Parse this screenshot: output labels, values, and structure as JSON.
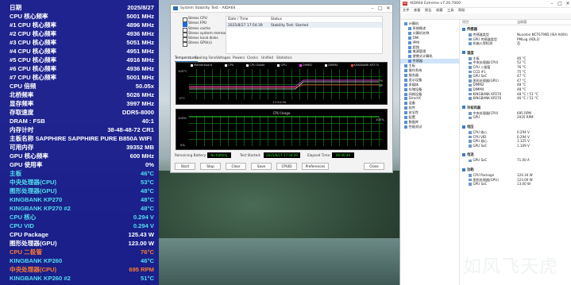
{
  "osd": {
    "rows": [
      {
        "k": "日期",
        "v": "2025/8/27",
        "c": "white"
      },
      {
        "k": "CPU 核心频率",
        "v": "5001 MHz",
        "c": "white"
      },
      {
        "k": "#1 CPU 核心频率",
        "v": "4896 MHz",
        "c": "white"
      },
      {
        "k": "#2 CPU 核心频率",
        "v": "4936 MHz",
        "c": "white"
      },
      {
        "k": "#3 CPU 核心频率",
        "v": "5051 MHz",
        "c": "white"
      },
      {
        "k": "#4 CPU 核心频率",
        "v": "4951 MHz",
        "c": "white"
      },
      {
        "k": "#5 CPU 核心频率",
        "v": "4916 MHz",
        "c": "white"
      },
      {
        "k": "#6 CPU 核心频率",
        "v": "4936 MHz",
        "c": "white"
      },
      {
        "k": "#7 CPU 核心频率",
        "v": "5001 MHz",
        "c": "white"
      },
      {
        "k": "CPU 倍频",
        "v": "50.05x",
        "c": "white"
      },
      {
        "k": "北桥频率",
        "v": "5026 MHz",
        "c": "white"
      },
      {
        "k": "显存频率",
        "v": "3997 MHz",
        "c": "white"
      },
      {
        "k": "存取速度",
        "v": "DDR5-8000",
        "c": "white"
      },
      {
        "k": "DRAM : FSB",
        "v": "40:1",
        "c": "white"
      },
      {
        "k": "内存计时",
        "v": "38-48-48-72 CR1",
        "c": "white"
      },
      {
        "k": "主板名称   SAPPHIRE SAPPHIRE PURE B850A WIFI",
        "v": "",
        "c": "white",
        "full": true
      },
      {
        "k": "可用内存",
        "v": "39352 MB",
        "c": "white"
      },
      {
        "k": "GPU 核心频率",
        "v": "600 MHz",
        "c": "white"
      },
      {
        "k": "GPU 使用率",
        "v": "0%",
        "c": "white"
      },
      {
        "k": "主板",
        "v": "46°C",
        "c": "cyan"
      },
      {
        "k": "中央处理器(CPU)",
        "v": "53°C",
        "c": "cyan"
      },
      {
        "k": "图形处理器(GPU)",
        "v": "48°C",
        "c": "cyan"
      },
      {
        "k": "KINGBANK KP270",
        "v": "48°C",
        "c": "cyan"
      },
      {
        "k": "KINGBANK KP270 #2",
        "v": "48°C",
        "c": "cyan"
      },
      {
        "k": "CPU 核心",
        "v": "0.294 V",
        "c": "cyan"
      },
      {
        "k": "CPU VID",
        "v": "0.294 V",
        "c": "cyan"
      },
      {
        "k": "CPU Package",
        "v": "125.43 W",
        "c": "white"
      },
      {
        "k": "图形处理器(GPU)",
        "v": "123.00 W",
        "c": "white"
      },
      {
        "k": "CPU 二极管",
        "v": "76°C",
        "c": "orange"
      },
      {
        "k": "KINGBANK KP260",
        "v": "46°C",
        "c": "cyan"
      },
      {
        "k": "中央处理器(CPU)",
        "v": "695 RPM",
        "c": "orange"
      },
      {
        "k": "KINGBANK KP260 #2",
        "v": "51°C",
        "c": "cyan"
      }
    ]
  },
  "stability": {
    "title": "System Stability Test - AIDA64",
    "checks": [
      {
        "label": "Stress CPU",
        "on": false
      },
      {
        "label": "Stress FPU",
        "on": true
      },
      {
        "label": "Stress cache",
        "on": false
      },
      {
        "label": "Stress system memory",
        "on": false
      },
      {
        "label": "Stress local disks",
        "on": false
      },
      {
        "label": "Stress GPU(s)",
        "on": false
      }
    ],
    "table_headers": {
      "date": "Date / Time",
      "status": "Status"
    },
    "table_row": {
      "date": "2025/8/27 17:54:39",
      "status": "Stability Test: Started"
    },
    "tabs": [
      "Temperatures",
      "Cooling Fans",
      "Voltages",
      "Powers",
      "Clocks",
      "Unified",
      "Statistics"
    ],
    "temp_graph": {
      "legend": [
        {
          "label": "Motherboard",
          "color": "#ffffff"
        },
        {
          "label": "CPU",
          "color": "#ffffff"
        },
        {
          "label": "CPU Diode",
          "color": "#ffffff"
        },
        {
          "label": "GPU",
          "color": "#ffffff"
        },
        {
          "label": "DIMM2",
          "color": "#ff44ff"
        },
        {
          "label": "DIMM4",
          "color": "#ffffff"
        },
        {
          "label": "KINGBANK KP270",
          "color": "#ff4444"
        }
      ],
      "ymax": "100°C",
      "ymin": "0°C",
      "time": "17:54:39",
      "right_vals": [
        "76",
        "48"
      ]
    },
    "cpu_graph": {
      "title": "CPU Usage",
      "ymax": "100%",
      "ymin": "0%",
      "right_val": "100%"
    },
    "footer": {
      "battery_label": "Remaining Battery:",
      "battery_value": "No battery",
      "started_label": "Test Started:",
      "started_value": "2025/8/27 17:54:39",
      "elapsed_label": "Elapsed Time:",
      "elapsed_value": "00:00:44"
    },
    "buttons": [
      "Start",
      "Stop",
      "Clear",
      "Save",
      "CPUID",
      "Preferences",
      "Close"
    ]
  },
  "aida": {
    "title": "AIDA64 Extreme v7.20.7000",
    "menu": [
      "文件",
      "查看",
      "报告",
      "收藏",
      "工具",
      "帮助"
    ],
    "tree": [
      {
        "label": "计算机",
        "indent": 1,
        "sel": false
      },
      {
        "label": "系统概述",
        "indent": 2,
        "sel": false
      },
      {
        "label": "计算机名称",
        "indent": 2,
        "sel": false
      },
      {
        "label": "DMI",
        "indent": 2,
        "sel": false
      },
      {
        "label": "IPMI",
        "indent": 2,
        "sel": false
      },
      {
        "label": "超频",
        "indent": 2,
        "sel": false
      },
      {
        "label": "电源管理",
        "indent": 2,
        "sel": false
      },
      {
        "label": "便携式计算机",
        "indent": 2,
        "sel": false
      },
      {
        "label": "传感器",
        "indent": 2,
        "sel": true
      },
      {
        "label": "主板",
        "indent": 1,
        "sel": false
      },
      {
        "label": "操作系统",
        "indent": 1,
        "sel": false
      },
      {
        "label": "服务器",
        "indent": 1,
        "sel": false
      },
      {
        "label": "显示设备",
        "indent": 1,
        "sel": false
      },
      {
        "label": "多媒体",
        "indent": 1,
        "sel": false
      },
      {
        "label": "存储设备",
        "indent": 1,
        "sel": false
      },
      {
        "label": "网络设备",
        "indent": 1,
        "sel": false
      },
      {
        "label": "DirectX",
        "indent": 1,
        "sel": false
      },
      {
        "label": "设备",
        "indent": 1,
        "sel": false
      },
      {
        "label": "软件",
        "indent": 1,
        "sel": false
      },
      {
        "label": "安全性",
        "indent": 1,
        "sel": false
      },
      {
        "label": "配置",
        "indent": 1,
        "sel": false
      },
      {
        "label": "数据库",
        "indent": 1,
        "sel": false
      },
      {
        "label": "性能测试",
        "indent": 1,
        "sel": false
      }
    ],
    "pane_headers": {
      "item": "项目",
      "value": "当前值"
    },
    "sections": [
      {
        "title": "传感器",
        "items": [
          {
            "k": "传感器类型",
            "v": "Nuvoton NCT6799D (ISA A40h)"
          },
          {
            "k": "GPU 传感器类型",
            "v": "PMLog (ADL2)"
          },
          {
            "k": "机箱入侵检测",
            "v": "否"
          }
        ]
      },
      {
        "title": "温度",
        "items": [
          {
            "k": "主板",
            "v": "46 °C"
          },
          {
            "k": "中央处理器(CPU)",
            "v": "52 °C"
          },
          {
            "k": "CPU 二极管",
            "v": "76 °C"
          },
          {
            "k": "CCD #1",
            "v": "75 °C"
          },
          {
            "k": "GPU SoC",
            "v": "47 °C"
          },
          {
            "k": "图形处理器(GPU)",
            "v": "47 °C"
          },
          {
            "k": "DIMM2",
            "v": "48 °C"
          },
          {
            "k": "DIMM4",
            "v": "48 °C"
          },
          {
            "k": "KINGBANK KP270",
            "v": "48 °C / 51 °C"
          },
          {
            "k": "KINGBANK KP270",
            "v": "46 °C / 51 °C"
          }
        ]
      },
      {
        "title": "冷却风扇",
        "items": [
          {
            "k": "中央处理器(CPU)",
            "v": "695 RPM"
          },
          {
            "k": "GPU",
            "v": "2935 RPM"
          }
        ]
      },
      {
        "title": "电压",
        "items": [
          {
            "k": "CPU 核心",
            "v": "0.294 V"
          },
          {
            "k": "CPU VID",
            "v": "0.294 V"
          },
          {
            "k": "GPU 核心",
            "v": "1.125 V"
          },
          {
            "k": "GPU SoC",
            "v": "1.109 V"
          }
        ]
      },
      {
        "title": "电流",
        "items": [
          {
            "k": "GPU SoC",
            "v": "71.00 A"
          }
        ]
      },
      {
        "title": "功耗",
        "items": [
          {
            "k": "CPU Package",
            "v": "124.34 W"
          },
          {
            "k": "图形处理器(GPU)",
            "v": "123.00 W"
          },
          {
            "k": "GPU SoC",
            "v": "13.00 W"
          }
        ]
      }
    ]
  },
  "watermark": "如风飞天虎"
}
